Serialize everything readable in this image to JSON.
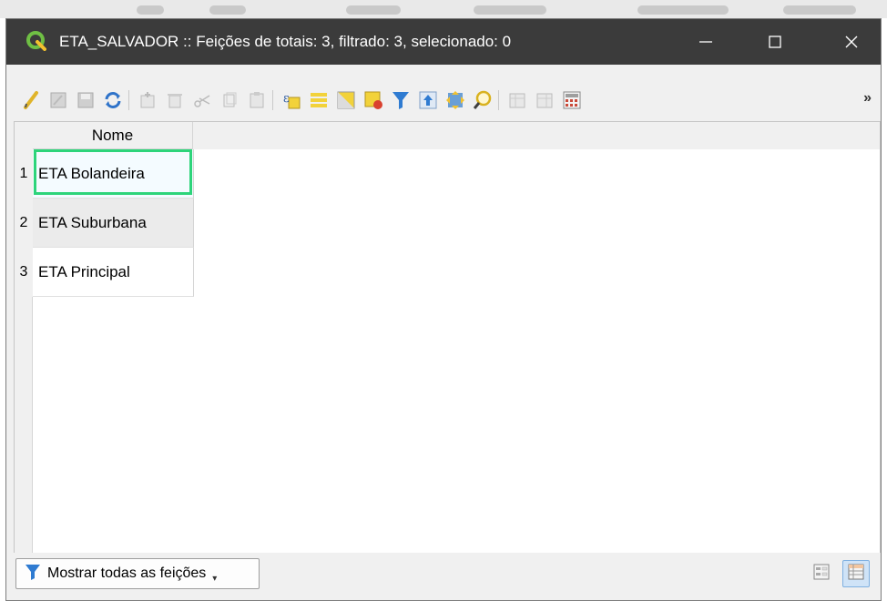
{
  "window": {
    "title": "ETA_SALVADOR :: Feições de totais: 3, filtrado: 3, selecionado: 0",
    "controls": {
      "minimize": "—",
      "maximize": "☐",
      "close": "✕"
    }
  },
  "toolbar": {
    "icons": [
      "edit-pencil-icon",
      "multi-edit-icon",
      "save-edits-icon",
      "reload-icon",
      "add-feature-icon",
      "delete-feature-icon",
      "cut-icon",
      "copy-icon",
      "paste-icon",
      "select-by-expression-icon",
      "select-all-icon",
      "invert-selection-icon",
      "deselect-all-icon",
      "filter-icon",
      "move-selection-top-icon",
      "pan-to-selection-icon",
      "zoom-to-selection-icon",
      "new-field-icon",
      "delete-field-icon",
      "field-calculator-icon"
    ],
    "more_label": "»"
  },
  "table": {
    "column_header": "Nome",
    "rows": [
      {
        "num": "1",
        "nome": "ETA Bolandeira"
      },
      {
        "num": "2",
        "nome": "ETA Suburbana"
      },
      {
        "num": "3",
        "nome": "ETA Principal"
      }
    ],
    "focus_color": "#2dd47a"
  },
  "bottom": {
    "filter_button_label": "Mostrar todas as feições",
    "view_mode": "table"
  },
  "colors": {
    "titlebar": "#3b3b3b",
    "accent_green": "#5aa13f",
    "filter_blue": "#2f7bd1"
  }
}
